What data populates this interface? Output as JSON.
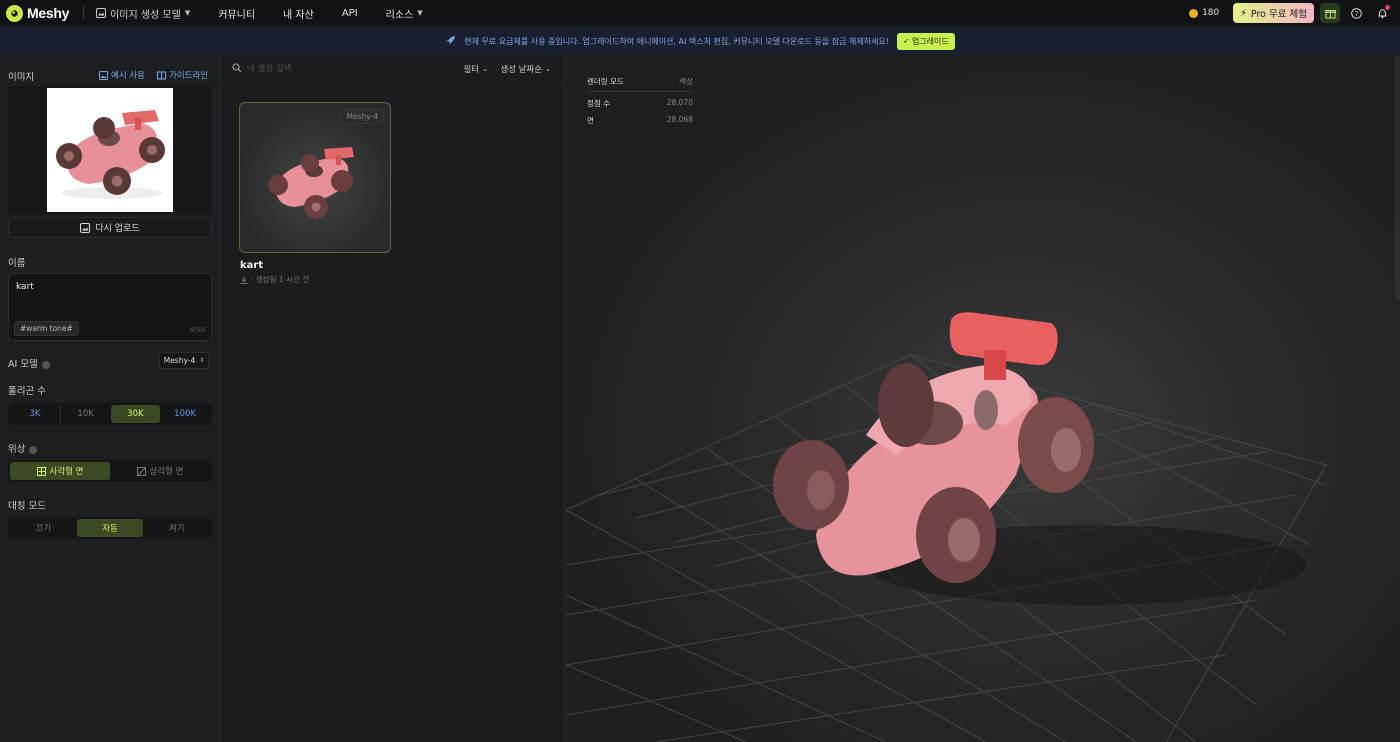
{
  "app": {
    "name": "Meshy"
  },
  "nav": {
    "mode": "이미지 생성 모델",
    "items": [
      "커뮤니티",
      "내 자산",
      "API",
      "리소스"
    ]
  },
  "header": {
    "credits": "180",
    "pro_label": "Pro 무료 체험"
  },
  "banner": {
    "text": "현재 무료 요금제를 사용 중입니다. 업그레이드하여 애니메이션, AI 텍스처 편집, 커뮤니티 모델 다운로드 등을 잠금 해제하세요!",
    "button": "업그레이드"
  },
  "left": {
    "image_label": "이미지",
    "example_link": "예시 사용",
    "guide_link": "가이드라인",
    "reupload": "다시 업로드",
    "name_label": "이름",
    "name_value": "kart",
    "tag": "#warm tone#",
    "counter": "4/50",
    "model_label": "AI 모델",
    "model_value": "Meshy-4",
    "poly_label": "폴리곤 수",
    "poly_options": [
      "3K",
      "10K",
      "30K",
      "100K"
    ],
    "topology_label": "위상",
    "topology_options": [
      "사각형 면",
      "삼각형 면"
    ],
    "symmetry_label": "대칭 모드",
    "symmetry_options": [
      "끄기",
      "자동",
      "켜기"
    ]
  },
  "middle": {
    "search_placeholder": "내 생성 검색",
    "filter": "필터",
    "sort": "생성 날짜순",
    "card": {
      "badge": "Meshy-4",
      "title": "kart",
      "meta": "· 생성됨 1 시간 전"
    }
  },
  "viewer": {
    "render_mode_label": "렌더링 모드",
    "render_mode_value": "색상",
    "vertices_label": "정점 수",
    "vertices_value": "28,070",
    "faces_label": "면",
    "faces_value": "28,068"
  },
  "colors": {
    "accent": "#c8f04e",
    "link": "#7aa7ea",
    "kart": "#e8909a"
  }
}
